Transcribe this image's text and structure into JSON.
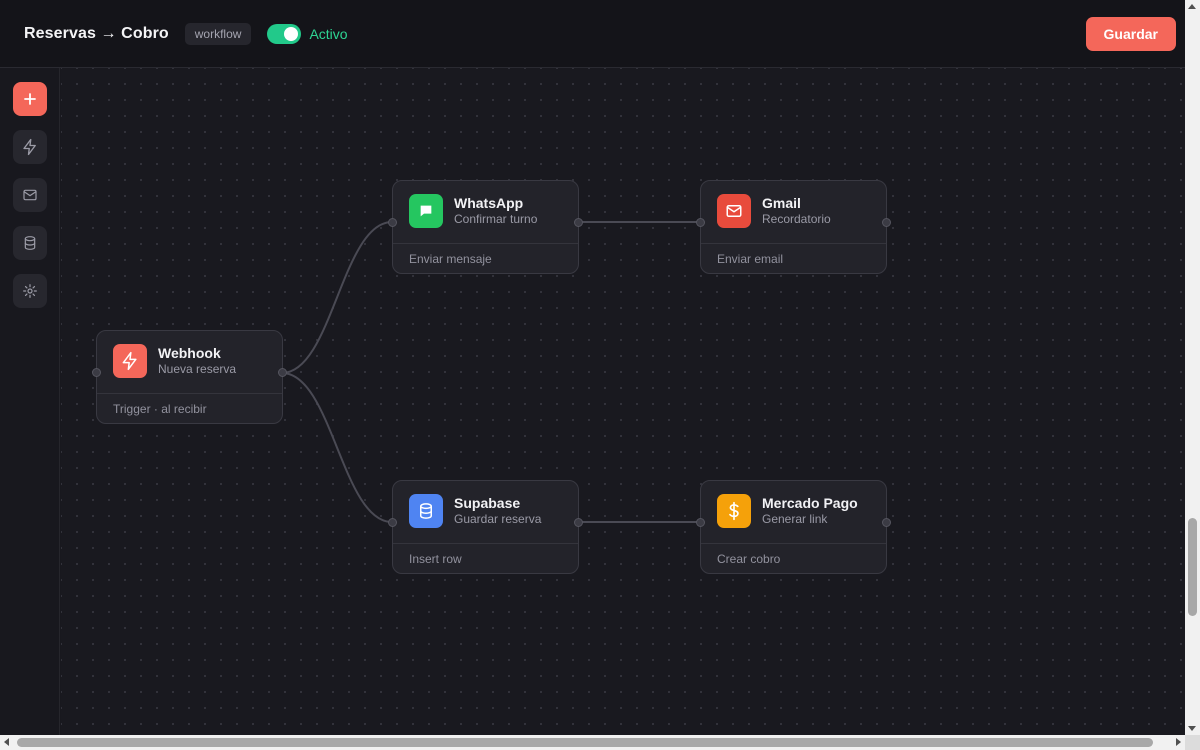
{
  "header": {
    "title": "Reservas → Cobro",
    "tag": "workflow",
    "toggle_on": true,
    "status": "Activo",
    "save_label": "Guardar"
  },
  "sidebar": {
    "items": [
      {
        "id": "add",
        "icon": "plus-icon"
      },
      {
        "id": "triggers",
        "icon": "bolt-icon"
      },
      {
        "id": "email",
        "icon": "mail-icon"
      },
      {
        "id": "database",
        "icon": "database-icon"
      },
      {
        "id": "settings",
        "icon": "gear-icon"
      }
    ]
  },
  "nodes": {
    "webhook": {
      "name": "Webhook",
      "subtitle": "Nueva reserva",
      "footer": "Trigger · al recibir",
      "icon": "bolt-icon",
      "color": "#f4675a"
    },
    "whatsapp": {
      "name": "WhatsApp",
      "subtitle": "Confirmar turno",
      "footer": "Enviar mensaje",
      "icon": "chat-icon",
      "color": "#25c660"
    },
    "gmail": {
      "name": "Gmail",
      "subtitle": "Recordatorio",
      "footer": "Enviar email",
      "icon": "mail-icon",
      "color": "#e84b3c"
    },
    "supabase": {
      "name": "Supabase",
      "subtitle": "Guardar reserva",
      "footer": "Insert row",
      "icon": "database-icon",
      "color": "#4f84f2"
    },
    "mercadopago": {
      "name": "Mercado Pago",
      "subtitle": "Generar link",
      "footer": "Crear cobro",
      "icon": "dollar-icon",
      "color": "#f5a10a"
    }
  },
  "connections": [
    {
      "from": "webhook",
      "to": "whatsapp"
    },
    {
      "from": "webhook",
      "to": "supabase"
    },
    {
      "from": "whatsapp",
      "to": "gmail"
    },
    {
      "from": "supabase",
      "to": "mercadopago"
    }
  ],
  "theme": {
    "accent": "#f4675a",
    "active_green": "#22c98a",
    "background": "#18181e",
    "node_bg": "#23232a"
  }
}
